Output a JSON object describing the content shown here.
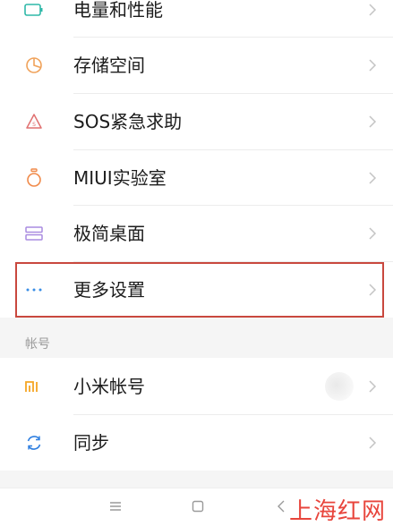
{
  "settings": {
    "items_top": [
      {
        "label": "电量和性能",
        "icon": "battery-icon"
      },
      {
        "label": "存储空间",
        "icon": "storage-pie-icon"
      },
      {
        "label": "SOS紧急求助",
        "icon": "sos-alert-icon"
      },
      {
        "label": "MIUI实验室",
        "icon": "lab-flask-icon"
      },
      {
        "label": "极简桌面",
        "icon": "simple-desktop-icon"
      },
      {
        "label": "更多设置",
        "icon": "more-dots-icon"
      }
    ],
    "account_section_title": "帐号",
    "items_account": [
      {
        "label": "小米帐号",
        "icon": "mi-logo-icon"
      },
      {
        "label": "同步",
        "icon": "sync-icon"
      }
    ]
  },
  "watermark": "上海红网",
  "colors": {
    "battery": "#2fb8a8",
    "storage": "#f0a25a",
    "sos": "#e07070",
    "lab": "#f08a4a",
    "desktop": "#a98be0",
    "more": "#3a8ee6",
    "mi": "#f5a623",
    "sync": "#2f7fe0",
    "highlight": "#c9483e",
    "watermark": "#e8453c"
  }
}
